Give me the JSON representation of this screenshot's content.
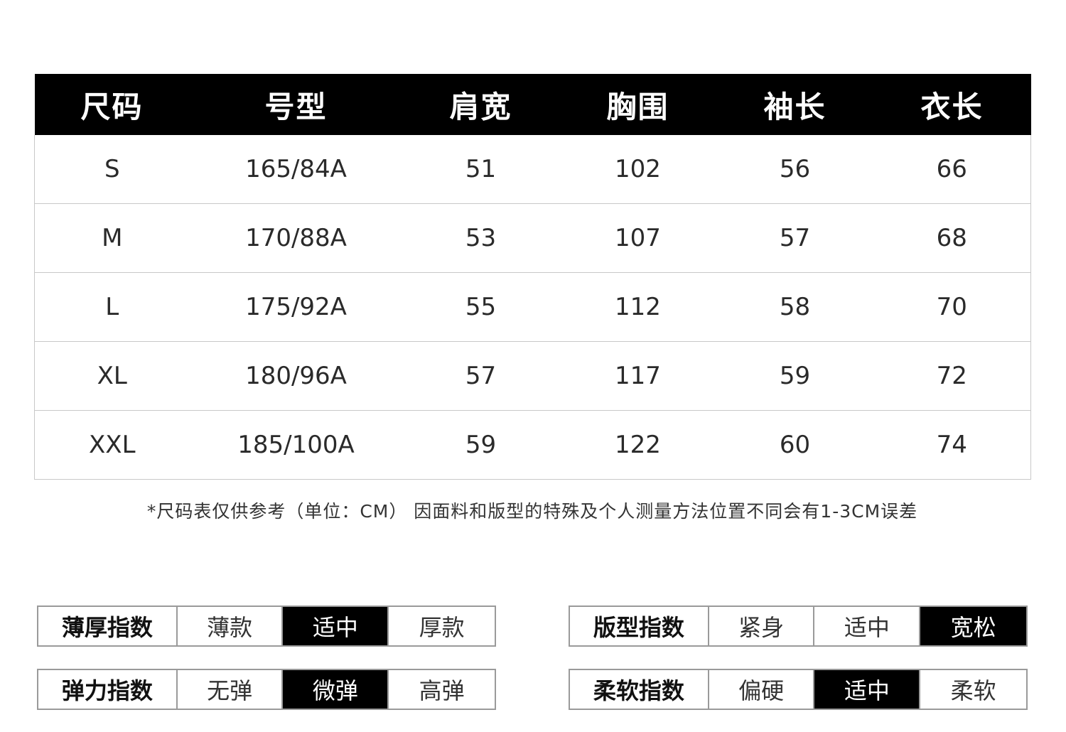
{
  "size_table": {
    "headers": [
      "尺码",
      "号型",
      "肩宽",
      "胸围",
      "袖长",
      "衣长"
    ],
    "rows": [
      [
        "S",
        "165/84A",
        "51",
        "102",
        "56",
        "66"
      ],
      [
        "M",
        "170/88A",
        "53",
        "107",
        "57",
        "68"
      ],
      [
        "L",
        "175/92A",
        "55",
        "112",
        "58",
        "70"
      ],
      [
        "XL",
        "180/96A",
        "57",
        "117",
        "59",
        "72"
      ],
      [
        "XXL",
        "185/100A",
        "59",
        "122",
        "60",
        "74"
      ]
    ]
  },
  "note": "*尺码表仅供参考（单位：CM） 因面料和版型的特殊及个人测量方法位置不同会有1-3CM误差",
  "indices": {
    "thickness": {
      "label": "薄厚指数",
      "options": [
        "薄款",
        "适中",
        "厚款"
      ],
      "selected": 1
    },
    "elastic": {
      "label": "弹力指数",
      "options": [
        "无弹",
        "微弹",
        "高弹"
      ],
      "selected": 1
    },
    "fit": {
      "label": "版型指数",
      "options": [
        "紧身",
        "适中",
        "宽松"
      ],
      "selected": 2
    },
    "soft": {
      "label": "柔软指数",
      "options": [
        "偏硬",
        "适中",
        "柔软"
      ],
      "selected": 1
    }
  },
  "colors": {
    "header_bg": "#000000",
    "header_text": "#ffffff",
    "active_bg": "#000000",
    "active_text": "#ffffff",
    "border": "#c8c8c8"
  }
}
